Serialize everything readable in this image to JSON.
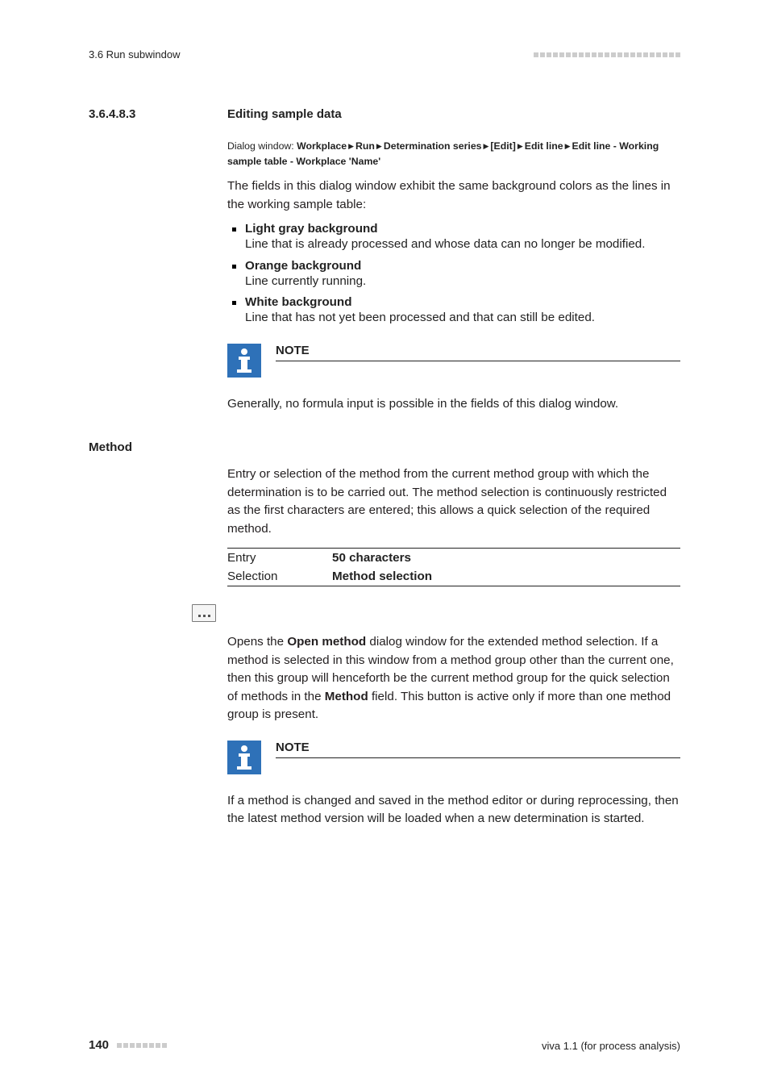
{
  "header": {
    "left": "3.6 Run subwindow"
  },
  "section": {
    "number": "3.6.4.8.3",
    "title": "Editing sample data"
  },
  "dialog": {
    "prefix": "Dialog window: ",
    "parts": [
      "Workplace",
      "Run",
      "Determination series",
      "[Edit]",
      "Edit line",
      "Edit line - Working sample table - Workplace 'Name'"
    ]
  },
  "intro": "The fields in this dialog window exhibit the same background colors as the lines in the working sample table:",
  "bullets": [
    {
      "title": "Light gray background",
      "body": "Line that is already processed and whose data can no longer be modified."
    },
    {
      "title": "Orange background",
      "body": "Line currently running."
    },
    {
      "title": "White background",
      "body": "Line that has not yet been processed and that can still be edited."
    }
  ],
  "note1": {
    "title": "NOTE",
    "body": "Generally, no formula input is possible in the fields of this dialog window."
  },
  "method": {
    "heading": "Method",
    "desc": "Entry or selection of the method from the current method group with which the determination is to be carried out. The method selection is continuously restricted as the first characters are entered; this allows a quick selection of the required method.",
    "rows": [
      {
        "k": "Entry",
        "v": "50 characters"
      },
      {
        "k": "Selection",
        "v": "Method selection"
      }
    ]
  },
  "open_method": {
    "p1a": "Opens the ",
    "p1b": "Open method",
    "p1c": " dialog window for the extended method selection. If a method is selected in this window from a method group other than the current one, then this group will henceforth be the current method group for the quick selection of methods in the ",
    "p1d": "Method",
    "p1e": " field. This button is active only if more than one method group is present."
  },
  "note2": {
    "title": "NOTE",
    "body": "If a method is changed and saved in the method editor or during reprocessing, then the latest method version will be loaded when a new determination is started."
  },
  "footer": {
    "page": "140",
    "right": "viva 1.1 (for process analysis)"
  }
}
